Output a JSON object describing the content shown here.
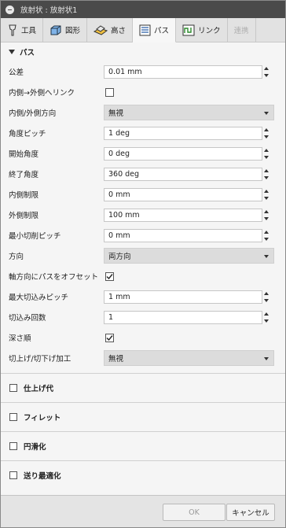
{
  "window": {
    "title": "放射状 : 放射状1"
  },
  "tabs": [
    {
      "label": "工具",
      "icon": "tool-icon"
    },
    {
      "label": "図形",
      "icon": "shape-icon"
    },
    {
      "label": "高さ",
      "icon": "height-icon"
    },
    {
      "label": "パス",
      "icon": "pass-icon"
    },
    {
      "label": "リンク",
      "icon": "link-icon"
    },
    {
      "label": "連携",
      "icon": "linking-icon"
    }
  ],
  "section": {
    "title": "パス"
  },
  "fields": {
    "tolerance": {
      "label": "公差",
      "value": "0.01 mm"
    },
    "inner_to_outer": {
      "label": "内側→外側へリンク",
      "checked": false
    },
    "direction_io": {
      "label": "内側/外側方向",
      "value": "無視"
    },
    "angle_pitch": {
      "label": "角度ピッチ",
      "value": "1 deg"
    },
    "start_angle": {
      "label": "開始角度",
      "value": "0 deg"
    },
    "end_angle": {
      "label": "終了角度",
      "value": "360 deg"
    },
    "inner_limit": {
      "label": "内側制限",
      "value": "0 mm"
    },
    "outer_limit": {
      "label": "外側制限",
      "value": "100 mm"
    },
    "min_cut_pitch": {
      "label": "最小切削ピッチ",
      "value": "0 mm"
    },
    "direction": {
      "label": "方向",
      "value": "両方向"
    },
    "axial_offset": {
      "label": "軸方向にパスをオフセット",
      "checked": true
    },
    "max_step": {
      "label": "最大切込みピッチ",
      "value": "1 mm"
    },
    "step_count": {
      "label": "切込み回数",
      "value": "1"
    },
    "depth_first": {
      "label": "深さ順",
      "checked": true
    },
    "up_down_cut": {
      "label": "切上げ/切下げ加工",
      "value": "無視"
    }
  },
  "groups": [
    {
      "label": "仕上げ代"
    },
    {
      "label": "フィレット"
    },
    {
      "label": "円滑化"
    },
    {
      "label": "送り最適化"
    }
  ],
  "buttons": {
    "ok": "OK",
    "cancel": "キャンセル"
  }
}
